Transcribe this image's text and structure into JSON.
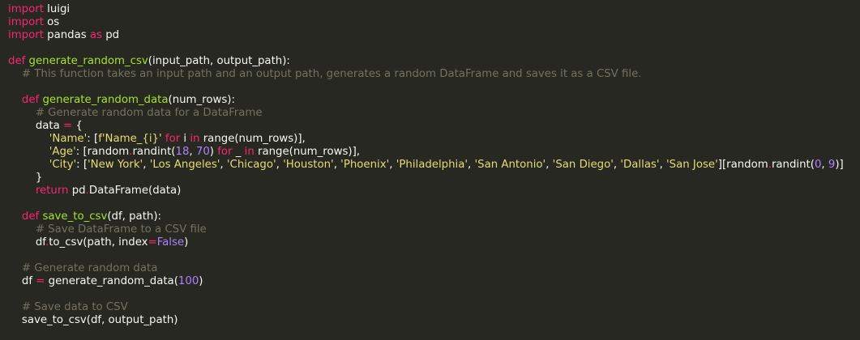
{
  "editor": {
    "lines": [
      [
        {
          "t": "import",
          "c": "kw"
        },
        {
          "t": " luigi",
          "c": "plain"
        }
      ],
      [
        {
          "t": "import",
          "c": "kw"
        },
        {
          "t": " os",
          "c": "plain"
        }
      ],
      [
        {
          "t": "import",
          "c": "kw"
        },
        {
          "t": " pandas ",
          "c": "plain"
        },
        {
          "t": "as",
          "c": "kw"
        },
        {
          "t": " pd",
          "c": "plain"
        }
      ],
      [],
      [
        {
          "t": "def ",
          "c": "kw"
        },
        {
          "t": "generate_random_csv",
          "c": "fn"
        },
        {
          "t": "(input_path, output_path):",
          "c": "plain"
        }
      ],
      [
        {
          "t": "    # This function takes an input path and an output path, generates a random DataFrame and saves it as a CSV file.",
          "c": "cmt"
        }
      ],
      [],
      [
        {
          "t": "    ",
          "c": "plain"
        },
        {
          "t": "def ",
          "c": "kw"
        },
        {
          "t": "generate_random_data",
          "c": "fn"
        },
        {
          "t": "(num_rows):",
          "c": "plain"
        }
      ],
      [
        {
          "t": "        # Generate random data for a DataFrame",
          "c": "cmt"
        }
      ],
      [
        {
          "t": "        data ",
          "c": "plain"
        },
        {
          "t": "=",
          "c": "kw"
        },
        {
          "t": " {",
          "c": "plain"
        }
      ],
      [
        {
          "t": "            ",
          "c": "plain"
        },
        {
          "t": "'Name'",
          "c": "str"
        },
        {
          "t": ": [",
          "c": "plain"
        },
        {
          "t": "f'Name_{i}'",
          "c": "str"
        },
        {
          "t": " ",
          "c": "plain"
        },
        {
          "t": "for",
          "c": "kw"
        },
        {
          "t": " i ",
          "c": "plain"
        },
        {
          "t": "in",
          "c": "kw"
        },
        {
          "t": " range(num_rows)],",
          "c": "plain"
        }
      ],
      [
        {
          "t": "            ",
          "c": "plain"
        },
        {
          "t": "'Age'",
          "c": "str"
        },
        {
          "t": ": [random",
          "c": "plain"
        },
        {
          "t": ".",
          "c": "kw"
        },
        {
          "t": "randint(",
          "c": "plain"
        },
        {
          "t": "18",
          "c": "num"
        },
        {
          "t": ", ",
          "c": "plain"
        },
        {
          "t": "70",
          "c": "num"
        },
        {
          "t": ") ",
          "c": "plain"
        },
        {
          "t": "for",
          "c": "kw"
        },
        {
          "t": " _ ",
          "c": "plain"
        },
        {
          "t": "in",
          "c": "kw"
        },
        {
          "t": " range(num_rows)],",
          "c": "plain"
        }
      ],
      [
        {
          "t": "            ",
          "c": "plain"
        },
        {
          "t": "'City'",
          "c": "str"
        },
        {
          "t": ": [",
          "c": "plain"
        },
        {
          "t": "'New York'",
          "c": "str"
        },
        {
          "t": ", ",
          "c": "plain"
        },
        {
          "t": "'Los Angeles'",
          "c": "str"
        },
        {
          "t": ", ",
          "c": "plain"
        },
        {
          "t": "'Chicago'",
          "c": "str"
        },
        {
          "t": ", ",
          "c": "plain"
        },
        {
          "t": "'Houston'",
          "c": "str"
        },
        {
          "t": ", ",
          "c": "plain"
        },
        {
          "t": "'Phoenix'",
          "c": "str"
        },
        {
          "t": ", ",
          "c": "plain"
        },
        {
          "t": "'Philadelphia'",
          "c": "str"
        },
        {
          "t": ", ",
          "c": "plain"
        },
        {
          "t": "'San Antonio'",
          "c": "str"
        },
        {
          "t": ", ",
          "c": "plain"
        },
        {
          "t": "'San Diego'",
          "c": "str"
        },
        {
          "t": ", ",
          "c": "plain"
        },
        {
          "t": "'Dallas'",
          "c": "str"
        },
        {
          "t": ", ",
          "c": "plain"
        },
        {
          "t": "'San Jose'",
          "c": "str"
        },
        {
          "t": "][random",
          "c": "plain"
        },
        {
          "t": ".",
          "c": "kw"
        },
        {
          "t": "randint(",
          "c": "plain"
        },
        {
          "t": "0",
          "c": "num"
        },
        {
          "t": ", ",
          "c": "plain"
        },
        {
          "t": "9",
          "c": "num"
        },
        {
          "t": ")]",
          "c": "plain"
        }
      ],
      [
        {
          "t": "        }",
          "c": "plain"
        }
      ],
      [
        {
          "t": "        ",
          "c": "plain"
        },
        {
          "t": "return",
          "c": "kw"
        },
        {
          "t": " pd",
          "c": "plain"
        },
        {
          "t": ".",
          "c": "kw"
        },
        {
          "t": "DataFrame(data)",
          "c": "plain"
        }
      ],
      [],
      [
        {
          "t": "    ",
          "c": "plain"
        },
        {
          "t": "def ",
          "c": "kw"
        },
        {
          "t": "save_to_csv",
          "c": "fn"
        },
        {
          "t": "(df, path):",
          "c": "plain"
        }
      ],
      [
        {
          "t": "        # Save DataFrame to a CSV file",
          "c": "cmt"
        }
      ],
      [
        {
          "t": "        df",
          "c": "plain"
        },
        {
          "t": ".",
          "c": "kw"
        },
        {
          "t": "to_csv(path, index",
          "c": "plain"
        },
        {
          "t": "=",
          "c": "kw"
        },
        {
          "t": "False",
          "c": "num"
        },
        {
          "t": ")",
          "c": "plain"
        }
      ],
      [],
      [
        {
          "t": "    # Generate random data",
          "c": "cmt"
        }
      ],
      [
        {
          "t": "    df ",
          "c": "plain"
        },
        {
          "t": "=",
          "c": "kw"
        },
        {
          "t": " generate_random_data(",
          "c": "plain"
        },
        {
          "t": "100",
          "c": "num"
        },
        {
          "t": ")",
          "c": "plain"
        }
      ],
      [],
      [
        {
          "t": "    # Save data to CSV",
          "c": "cmt"
        }
      ],
      [
        {
          "t": "    save_to_csv(df, output_path)",
          "c": "plain"
        }
      ]
    ]
  },
  "colors": {
    "background": "#272822",
    "keyword": "#f92672",
    "function": "#a6e22e",
    "string": "#e6db74",
    "number": "#ae81ff",
    "comment": "#75715e",
    "text": "#f8f8f2"
  }
}
